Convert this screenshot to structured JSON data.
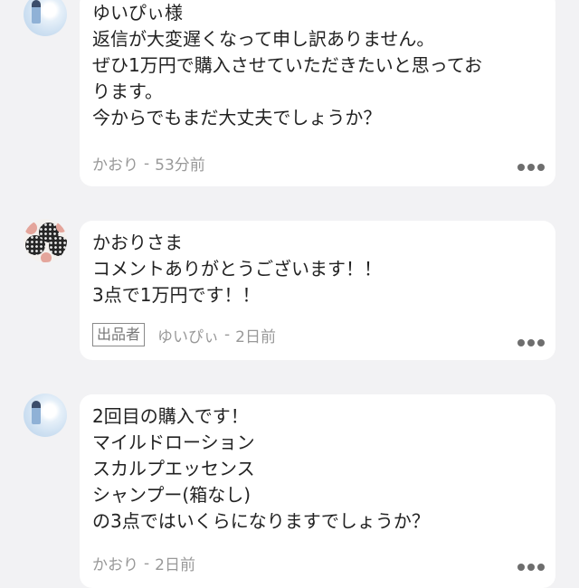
{
  "comments": [
    {
      "avatar_icon": "sky-photo-avatar",
      "text": "ゆいぴぃ様\n返信が大変遅くなって申し訳ありません。\nぜひ1万円で購入させていただきたいと思ってお\nります。\n今からでもまだ大丈夫でしょうか？",
      "author": "かおり",
      "separator": "-",
      "time": "53分前",
      "badge": null
    },
    {
      "avatar_icon": "polka-dot-avatar",
      "text": "かおりさま\nコメントありがとうございます！！\n3点で1万円です！！",
      "author": "ゆいぴぃ",
      "separator": "-",
      "time": "2日前",
      "badge": "出品者"
    },
    {
      "avatar_icon": "sky-photo-avatar",
      "text": "2回目の購入です！\nマイルドローション\nスカルプエッセンス\nシャンプー(箱なし)\nの3点ではいくらになりますでしょうか？",
      "author": "かおり",
      "separator": "-",
      "time": "2日前",
      "badge": null
    }
  ],
  "icons": {
    "more": "more-dots-icon"
  },
  "colors": {
    "background": "#f2f2f4",
    "bubble": "#ffffff",
    "meta_text": "#999999"
  }
}
